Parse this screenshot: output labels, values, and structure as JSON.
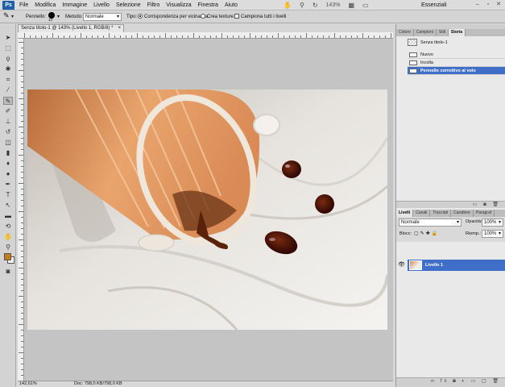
{
  "app": {
    "logo": "Ps"
  },
  "menu": [
    "File",
    "Modifica",
    "Immagine",
    "Livello",
    "Selezione",
    "Filtro",
    "Visualizza",
    "Finestra",
    "Aiuto"
  ],
  "menu_zoom": "143%",
  "workspace": "Essenziali",
  "options": {
    "brush_label": "Pennello:",
    "brush_size": "13",
    "mode_label": "Metodo:",
    "mode_value": "Normale",
    "type_label": "Tipo:",
    "radio_1": "Corrispondenza per vicinanza",
    "radio_2": "Crea texture",
    "check_1": "Campiona tutti i livelli"
  },
  "document": {
    "tab_title": "Senza titolo-1 @ 143% (Livello 1, RGB/8) *",
    "status_zoom": "142,61%",
    "status_doc": "Doc: 798,0 KB/798,0 KB"
  },
  "history_panel": {
    "tabs": [
      "Colore",
      "Campioni",
      "Stili",
      "Storia"
    ],
    "active_tab": "Storia",
    "snapshot": "Senza titolo-1",
    "states": [
      "Nuovo",
      "Incolla",
      "Pennello correttivo al volo"
    ]
  },
  "layers_panel": {
    "tabs": [
      "Livelli",
      "Canali",
      "Tracciati",
      "Carattere",
      "Paragraf"
    ],
    "blend_mode": "Normale",
    "opacity_label": "Opacità:",
    "opacity_value": "100%",
    "lock_label": "Blocc:",
    "fill_label": "Riemp.:",
    "fill_value": "100%",
    "layers": [
      "Livello 1"
    ]
  },
  "colors": {
    "foreground": "#c77a18",
    "selection": "#3f6fc9"
  }
}
